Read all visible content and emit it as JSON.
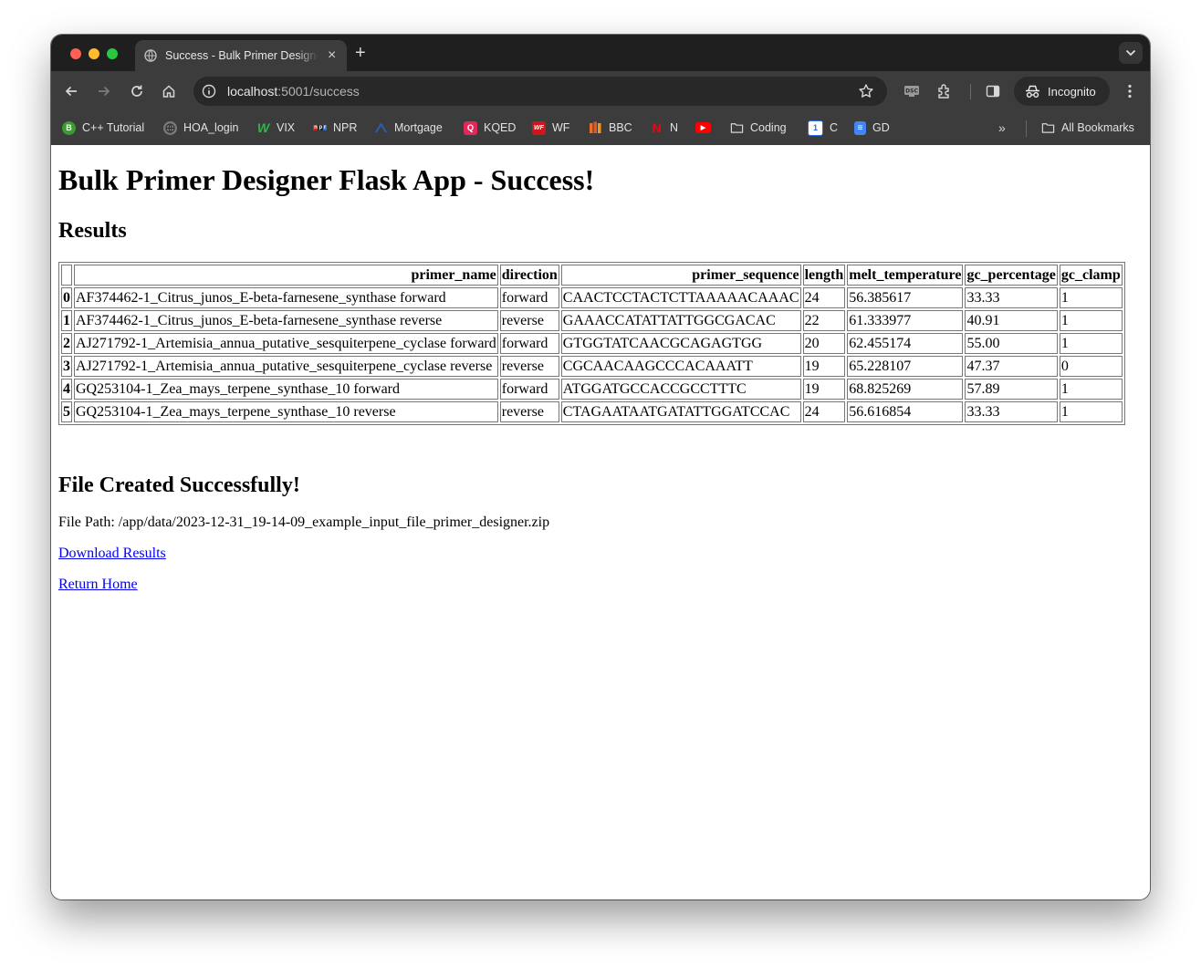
{
  "browser": {
    "tab_title": "Success - Bulk Primer Designer",
    "url_host": "localhost",
    "url_path": ":5001/success",
    "profile_label": "Incognito",
    "bookmarks": [
      {
        "label": "C++ Tutorial",
        "icon": "c-plus-plus-icon",
        "color": "#3d9b35",
        "glyph": "B"
      },
      {
        "label": "HOA_login",
        "icon": "globe-icon",
        "color": "#9a9a9a",
        "glyph": ""
      },
      {
        "label": "VIX",
        "icon": "w-icon",
        "color": "#2e9e4b",
        "glyph": "W"
      },
      {
        "label": "NPR",
        "icon": "npr-icon",
        "color": "#2f2f2f",
        "glyph": "npr"
      },
      {
        "label": "Mortgage",
        "icon": "mortgage-icon",
        "color": "#2d5fa8",
        "glyph": "^"
      },
      {
        "label": "KQED",
        "icon": "kqed-icon",
        "color": "#e0285a",
        "glyph": "Q"
      },
      {
        "label": "WF",
        "icon": "wf-icon",
        "color": "#d0161d",
        "glyph": "WF"
      },
      {
        "label": "BBC",
        "icon": "bbc-icon",
        "color": "#e8571e",
        "glyph": "B"
      },
      {
        "label": "N",
        "icon": "netflix-icon",
        "color": "#e50914",
        "glyph": "N"
      },
      {
        "label": "",
        "icon": "youtube-icon",
        "color": "#ff0000",
        "glyph": "▶"
      },
      {
        "label": "Coding",
        "icon": "folder-icon",
        "color": "",
        "glyph": ""
      },
      {
        "label": "C",
        "icon": "calendar-icon",
        "color": "#2f6fe4",
        "glyph": "1"
      },
      {
        "label": "GD",
        "icon": "docs-icon",
        "color": "#4285f4",
        "glyph": "≡"
      }
    ],
    "all_bookmarks_label": "All Bookmarks"
  },
  "page": {
    "heading": "Bulk Primer Designer Flask App - Success!",
    "results_heading": "Results",
    "file_heading": "File Created Successfully!",
    "file_path_text": "File Path: /app/data/2023-12-31_19-14-09_example_input_file_primer_designer.zip",
    "download_link": "Download Results",
    "home_link": "Return Home"
  },
  "table": {
    "columns": [
      "",
      "primer_name",
      "direction",
      "primer_sequence",
      "length",
      "melt_temperature",
      "gc_percentage",
      "gc_clamp"
    ],
    "rows": [
      [
        "0",
        "AF374462-1_Citrus_junos_E-beta-farnesene_synthase forward",
        "forward",
        "CAACTCCTACTCTTAAAAACAAAC",
        "24",
        "56.385617",
        "33.33",
        "1"
      ],
      [
        "1",
        "AF374462-1_Citrus_junos_E-beta-farnesene_synthase reverse",
        "reverse",
        "GAAACCATATTATTGGCGACAC",
        "22",
        "61.333977",
        "40.91",
        "1"
      ],
      [
        "2",
        "AJ271792-1_Artemisia_annua_putative_sesquiterpene_cyclase forward",
        "forward",
        "GTGGTATCAACGCAGAGTGG",
        "20",
        "62.455174",
        "55.00",
        "1"
      ],
      [
        "3",
        "AJ271792-1_Artemisia_annua_putative_sesquiterpene_cyclase reverse",
        "reverse",
        "CGCAACAAGCCCACAAATT",
        "19",
        "65.228107",
        "47.37",
        "0"
      ],
      [
        "4",
        "GQ253104-1_Zea_mays_terpene_synthase_10 forward",
        "forward",
        "ATGGATGCCACCGCCTTTC",
        "19",
        "68.825269",
        "57.89",
        "1"
      ],
      [
        "5",
        "GQ253104-1_Zea_mays_terpene_synthase_10 reverse",
        "reverse",
        "CTAGAATAATGATATTGGATCCAC",
        "24",
        "56.616854",
        "33.33",
        "1"
      ]
    ]
  }
}
